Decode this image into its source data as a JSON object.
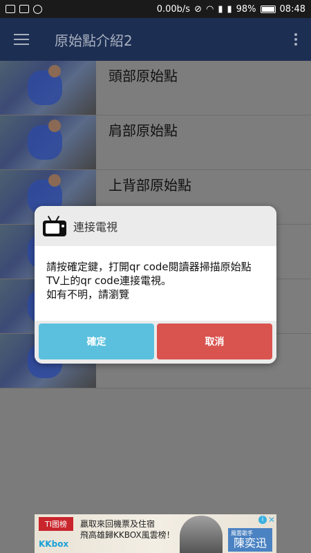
{
  "status_bar": {
    "net_speed": "0.00b/s",
    "battery": "98%",
    "time": "08:48"
  },
  "app_bar": {
    "title": "原始點介紹2"
  },
  "list": {
    "items": [
      {
        "label": "頭部原始點"
      },
      {
        "label": "肩部原始點"
      },
      {
        "label": "上背部原始點"
      },
      {
        "label": ""
      },
      {
        "label": ""
      },
      {
        "label": ""
      }
    ]
  },
  "dialog": {
    "title": "連接電視",
    "message_line1": "請按確定鍵，打開qr code閱讀器掃描原始點",
    "message_line2": "TV上的qr code連接電視。",
    "message_line3": "如有不明，請瀏覽",
    "ok_label": "確定",
    "cancel_label": "取消"
  },
  "ad": {
    "logo_top": "TI图榜",
    "logo_bottom": "KKbox",
    "line1": "贏取來回機票及住宿",
    "line2": "飛高雄歸KKBOX風雲榜！",
    "badge_small": "風雲歌手",
    "badge_name": "陳奕迅",
    "info": "i",
    "close": "✕"
  }
}
